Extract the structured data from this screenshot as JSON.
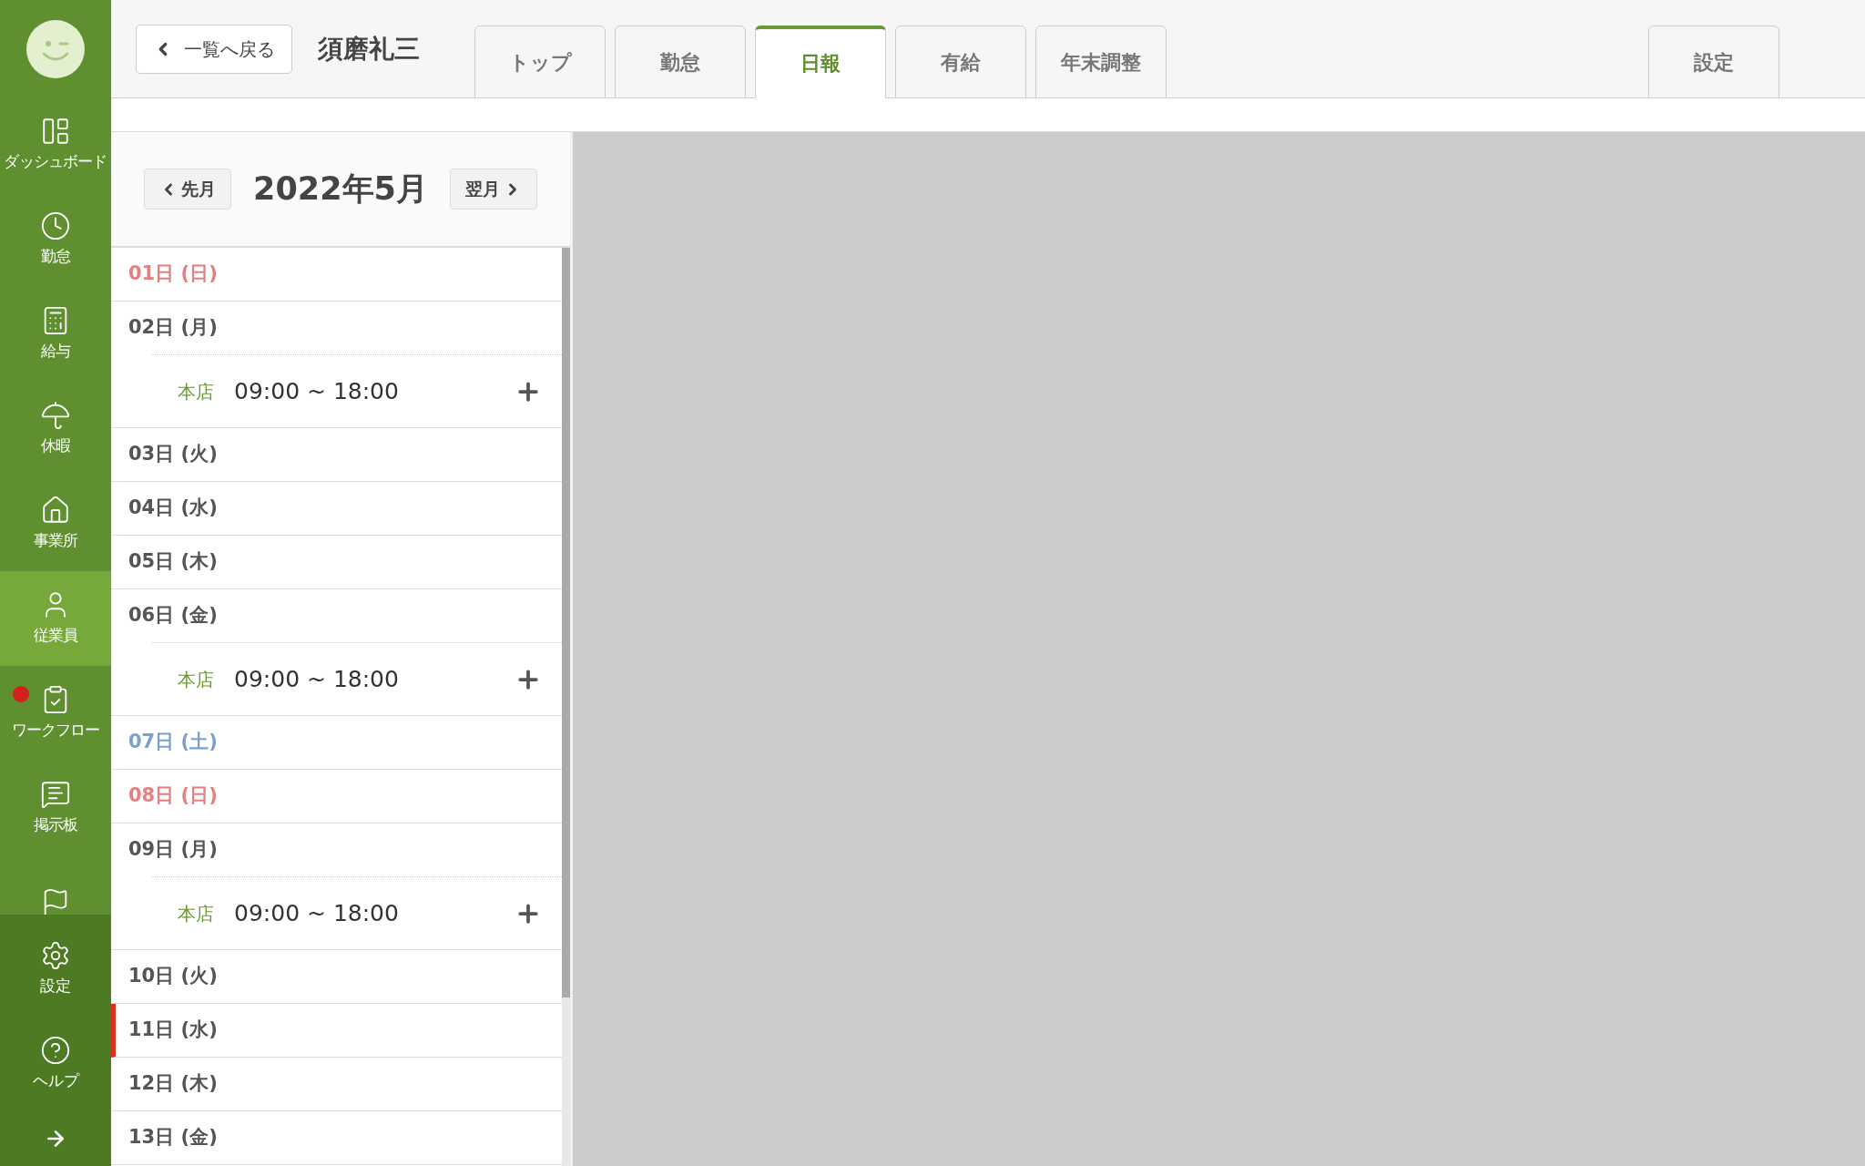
{
  "sidebar": {
    "items": [
      {
        "label": "ダッシュボード",
        "selected": false
      },
      {
        "label": "勤怠",
        "selected": false
      },
      {
        "label": "給与",
        "selected": false
      },
      {
        "label": "休暇",
        "selected": false
      },
      {
        "label": "事業所",
        "selected": false
      },
      {
        "label": "従業員",
        "selected": true
      },
      {
        "label": "ワークフロー",
        "selected": false,
        "notification": true
      },
      {
        "label": "掲示板",
        "selected": false
      },
      {
        "selected": false
      }
    ],
    "bottom_items": [
      {
        "label": "設定"
      },
      {
        "label": "ヘルプ"
      }
    ]
  },
  "header": {
    "back_button": "一覧へ戻る",
    "employee_name": "須磨礼三",
    "tabs": [
      {
        "label": "トップ",
        "selected": false
      },
      {
        "label": "勤怠",
        "selected": false
      },
      {
        "label": "日報",
        "selected": true
      },
      {
        "label": "有給",
        "selected": false
      },
      {
        "label": "年末調整",
        "selected": false
      }
    ],
    "settings_tab": {
      "label": "設定",
      "selected": false
    }
  },
  "month_nav": {
    "prev": "先月",
    "title": "2022年5月",
    "next": "翌月"
  },
  "days": [
    {
      "label": "01日 (日)",
      "color": "#e58080",
      "today": false
    },
    {
      "label": "02日 (月)",
      "color": "#555555",
      "today": false,
      "shifts": [
        {
          "location": "本店",
          "time": "09:00 ~ 18:00"
        }
      ]
    },
    {
      "label": "03日 (火)",
      "color": "#555555",
      "today": false
    },
    {
      "label": "04日 (水)",
      "color": "#555555",
      "today": false
    },
    {
      "label": "05日 (木)",
      "color": "#555555",
      "today": false
    },
    {
      "label": "06日 (金)",
      "color": "#555555",
      "today": false,
      "shifts": [
        {
          "location": "本店",
          "time": "09:00 ~ 18:00"
        }
      ]
    },
    {
      "label": "07日 (土)",
      "color": "#7aa2cc",
      "today": false
    },
    {
      "label": "08日 (日)",
      "color": "#e58080",
      "today": false
    },
    {
      "label": "09日 (月)",
      "color": "#555555",
      "today": false,
      "shifts": [
        {
          "location": "本店",
          "time": "09:00 ~ 18:00"
        }
      ]
    },
    {
      "label": "10日 (火)",
      "color": "#555555",
      "today": false
    },
    {
      "label": "11日 (水)",
      "color": "#555555",
      "today": true
    },
    {
      "label": "12日 (木)",
      "color": "#555555",
      "today": false
    },
    {
      "label": "13日 (金)",
      "color": "#555555",
      "today": false
    }
  ]
}
